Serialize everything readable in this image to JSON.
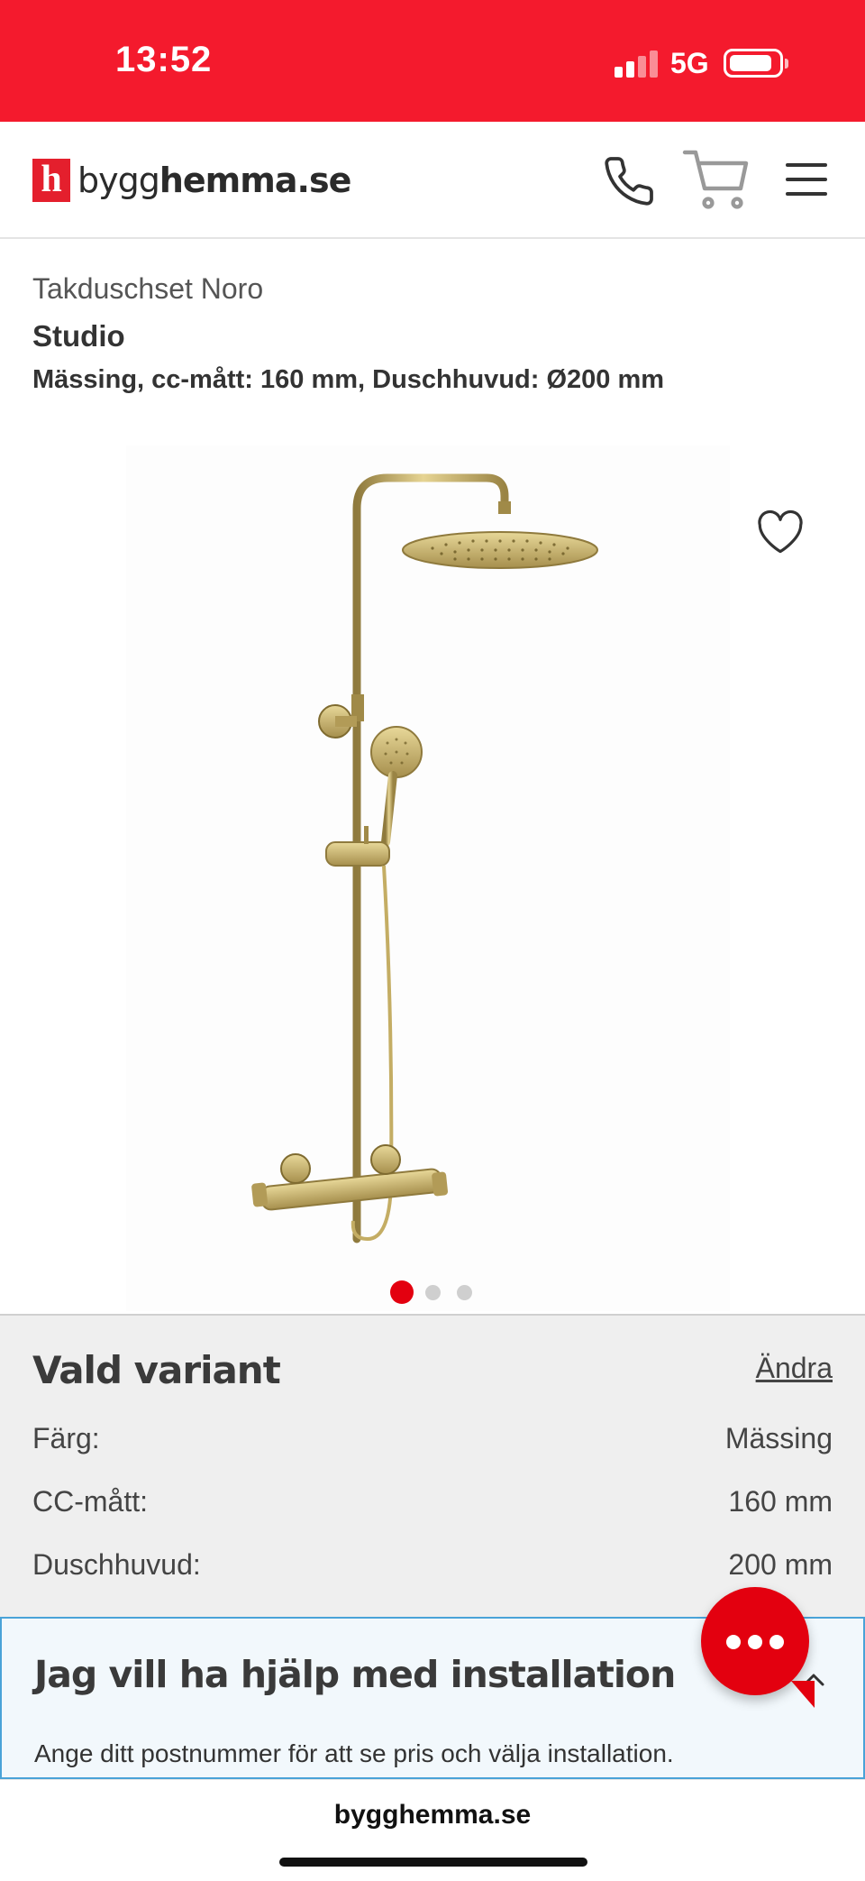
{
  "status_bar": {
    "time": "13:52",
    "network": "5G",
    "color": "#f41a2d"
  },
  "header": {
    "logo_mark": "h",
    "logo_text_a": "bygg",
    "logo_text_b": "hemma",
    "logo_text_c": ".se",
    "icons": [
      "phone-icon",
      "cart-icon",
      "menu-icon"
    ]
  },
  "product": {
    "brand": "Takduschset Noro",
    "name": "Studio",
    "spec": "Mässing, cc-mått: 160 mm, Duschhuvud: Ø200 mm",
    "image_count": 3,
    "active_image": 1
  },
  "variant": {
    "title": "Vald variant",
    "change_label": "Ändra",
    "rows": [
      {
        "label": "Färg:",
        "value": "Mässing"
      },
      {
        "label": "CC-mått:",
        "value": "160 mm"
      },
      {
        "label": "Duschhuvud:",
        "value": "200 mm"
      }
    ]
  },
  "installation": {
    "title": "Jag vill ha hjälp med installation",
    "text": "Ange ditt postnummer för att se pris och välja installation."
  },
  "browser": {
    "url": "bygghemma.se"
  },
  "colors": {
    "brand_red": "#e41f2d",
    "chat_red": "#e3000f",
    "install_border": "#4aa3d8",
    "gold": "#c9b26b"
  }
}
